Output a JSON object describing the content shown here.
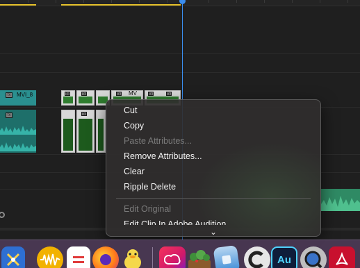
{
  "context_menu": {
    "items": [
      {
        "label": "Cut",
        "enabled": true
      },
      {
        "label": "Copy",
        "enabled": true
      },
      {
        "label": "Paste Attributes...",
        "enabled": false
      },
      {
        "label": "Remove Attributes...",
        "enabled": true
      },
      {
        "label": "Clear",
        "enabled": true
      },
      {
        "label": "Ripple Delete",
        "enabled": true
      }
    ],
    "after_separator": [
      {
        "label": "Edit Original",
        "enabled": false
      },
      {
        "label": "Edit Clip In Adobe Audition",
        "enabled": true
      }
    ],
    "more_indicator": "⌄"
  },
  "timeline": {
    "clip_label": "MVI_8",
    "green_clip_label": "MV",
    "fx_badge": "fx"
  },
  "dock": {
    "icons": [
      {
        "name": "xcode-instruments",
        "color": "#1d6fd6"
      },
      {
        "name": "audio-waveform-app",
        "color": "#f2b200"
      },
      {
        "name": "equals-app",
        "color": "#ffffff"
      },
      {
        "name": "firefox",
        "color": "#ff7a1a"
      },
      {
        "name": "cyberduck",
        "color": "#f4d84b"
      },
      {
        "name": "creative-cloud",
        "color": "#e03a3a"
      },
      {
        "name": "plants-app",
        "color": "#4a8a3a"
      },
      {
        "name": "icloud-app",
        "color": "#3a8ad6"
      },
      {
        "name": "c-app",
        "color": "#2c2c2c"
      },
      {
        "name": "audition",
        "color": "#0f1d3a"
      },
      {
        "name": "quicktime",
        "color": "#3a3a3a"
      },
      {
        "name": "acrobat",
        "color": "#c8102e"
      }
    ],
    "audition_label": "Au"
  }
}
